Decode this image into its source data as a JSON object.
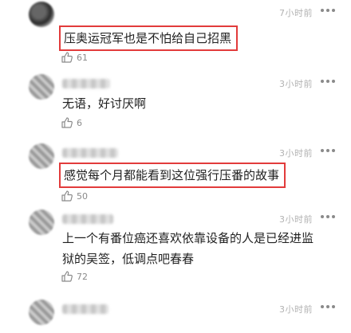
{
  "comments": [
    {
      "time": "7小时前",
      "text": "压奥运冠军也是不怕给自己招黑",
      "likes": "61",
      "highlighted": true
    },
    {
      "time": "3小时前",
      "text": "无语，好讨厌啊",
      "likes": "6",
      "highlighted": false
    },
    {
      "time": "3小时前",
      "text": "感觉每个月都能看到这位强行压番的故事",
      "likes": "50",
      "highlighted": true
    },
    {
      "time": "3小时前",
      "text": "上一个有番位癌还喜欢依靠设备的人是已经进监狱的吴签，低调点吧春春",
      "likes": "72",
      "highlighted": false
    },
    {
      "time": "3小时前"
    }
  ],
  "icons": {
    "like": "thumbs-up-icon",
    "more": "more-dots-icon",
    "avatar": "blurred-avatar"
  },
  "colors": {
    "highlight_border": "#e23b3b",
    "meta_text": "#b2b2b2",
    "count_text": "#8a8a8a"
  }
}
